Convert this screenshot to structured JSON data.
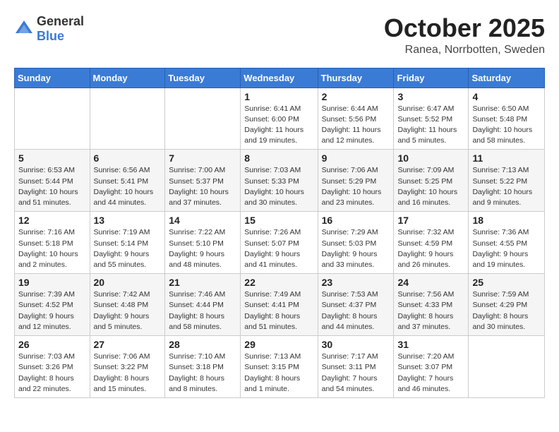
{
  "header": {
    "logo_general": "General",
    "logo_blue": "Blue",
    "month": "October 2025",
    "location": "Ranea, Norrbotten, Sweden"
  },
  "weekdays": [
    "Sunday",
    "Monday",
    "Tuesday",
    "Wednesday",
    "Thursday",
    "Friday",
    "Saturday"
  ],
  "weeks": [
    [
      {
        "day": "",
        "info": ""
      },
      {
        "day": "",
        "info": ""
      },
      {
        "day": "",
        "info": ""
      },
      {
        "day": "1",
        "info": "Sunrise: 6:41 AM\nSunset: 6:00 PM\nDaylight: 11 hours\nand 19 minutes."
      },
      {
        "day": "2",
        "info": "Sunrise: 6:44 AM\nSunset: 5:56 PM\nDaylight: 11 hours\nand 12 minutes."
      },
      {
        "day": "3",
        "info": "Sunrise: 6:47 AM\nSunset: 5:52 PM\nDaylight: 11 hours\nand 5 minutes."
      },
      {
        "day": "4",
        "info": "Sunrise: 6:50 AM\nSunset: 5:48 PM\nDaylight: 10 hours\nand 58 minutes."
      }
    ],
    [
      {
        "day": "5",
        "info": "Sunrise: 6:53 AM\nSunset: 5:44 PM\nDaylight: 10 hours\nand 51 minutes."
      },
      {
        "day": "6",
        "info": "Sunrise: 6:56 AM\nSunset: 5:41 PM\nDaylight: 10 hours\nand 44 minutes."
      },
      {
        "day": "7",
        "info": "Sunrise: 7:00 AM\nSunset: 5:37 PM\nDaylight: 10 hours\nand 37 minutes."
      },
      {
        "day": "8",
        "info": "Sunrise: 7:03 AM\nSunset: 5:33 PM\nDaylight: 10 hours\nand 30 minutes."
      },
      {
        "day": "9",
        "info": "Sunrise: 7:06 AM\nSunset: 5:29 PM\nDaylight: 10 hours\nand 23 minutes."
      },
      {
        "day": "10",
        "info": "Sunrise: 7:09 AM\nSunset: 5:25 PM\nDaylight: 10 hours\nand 16 minutes."
      },
      {
        "day": "11",
        "info": "Sunrise: 7:13 AM\nSunset: 5:22 PM\nDaylight: 10 hours\nand 9 minutes."
      }
    ],
    [
      {
        "day": "12",
        "info": "Sunrise: 7:16 AM\nSunset: 5:18 PM\nDaylight: 10 hours\nand 2 minutes."
      },
      {
        "day": "13",
        "info": "Sunrise: 7:19 AM\nSunset: 5:14 PM\nDaylight: 9 hours\nand 55 minutes."
      },
      {
        "day": "14",
        "info": "Sunrise: 7:22 AM\nSunset: 5:10 PM\nDaylight: 9 hours\nand 48 minutes."
      },
      {
        "day": "15",
        "info": "Sunrise: 7:26 AM\nSunset: 5:07 PM\nDaylight: 9 hours\nand 41 minutes."
      },
      {
        "day": "16",
        "info": "Sunrise: 7:29 AM\nSunset: 5:03 PM\nDaylight: 9 hours\nand 33 minutes."
      },
      {
        "day": "17",
        "info": "Sunrise: 7:32 AM\nSunset: 4:59 PM\nDaylight: 9 hours\nand 26 minutes."
      },
      {
        "day": "18",
        "info": "Sunrise: 7:36 AM\nSunset: 4:55 PM\nDaylight: 9 hours\nand 19 minutes."
      }
    ],
    [
      {
        "day": "19",
        "info": "Sunrise: 7:39 AM\nSunset: 4:52 PM\nDaylight: 9 hours\nand 12 minutes."
      },
      {
        "day": "20",
        "info": "Sunrise: 7:42 AM\nSunset: 4:48 PM\nDaylight: 9 hours\nand 5 minutes."
      },
      {
        "day": "21",
        "info": "Sunrise: 7:46 AM\nSunset: 4:44 PM\nDaylight: 8 hours\nand 58 minutes."
      },
      {
        "day": "22",
        "info": "Sunrise: 7:49 AM\nSunset: 4:41 PM\nDaylight: 8 hours\nand 51 minutes."
      },
      {
        "day": "23",
        "info": "Sunrise: 7:53 AM\nSunset: 4:37 PM\nDaylight: 8 hours\nand 44 minutes."
      },
      {
        "day": "24",
        "info": "Sunrise: 7:56 AM\nSunset: 4:33 PM\nDaylight: 8 hours\nand 37 minutes."
      },
      {
        "day": "25",
        "info": "Sunrise: 7:59 AM\nSunset: 4:29 PM\nDaylight: 8 hours\nand 30 minutes."
      }
    ],
    [
      {
        "day": "26",
        "info": "Sunrise: 7:03 AM\nSunset: 3:26 PM\nDaylight: 8 hours\nand 22 minutes."
      },
      {
        "day": "27",
        "info": "Sunrise: 7:06 AM\nSunset: 3:22 PM\nDaylight: 8 hours\nand 15 minutes."
      },
      {
        "day": "28",
        "info": "Sunrise: 7:10 AM\nSunset: 3:18 PM\nDaylight: 8 hours\nand 8 minutes."
      },
      {
        "day": "29",
        "info": "Sunrise: 7:13 AM\nSunset: 3:15 PM\nDaylight: 8 hours\nand 1 minute."
      },
      {
        "day": "30",
        "info": "Sunrise: 7:17 AM\nSunset: 3:11 PM\nDaylight: 7 hours\nand 54 minutes."
      },
      {
        "day": "31",
        "info": "Sunrise: 7:20 AM\nSunset: 3:07 PM\nDaylight: 7 hours\nand 46 minutes."
      },
      {
        "day": "",
        "info": ""
      }
    ]
  ]
}
